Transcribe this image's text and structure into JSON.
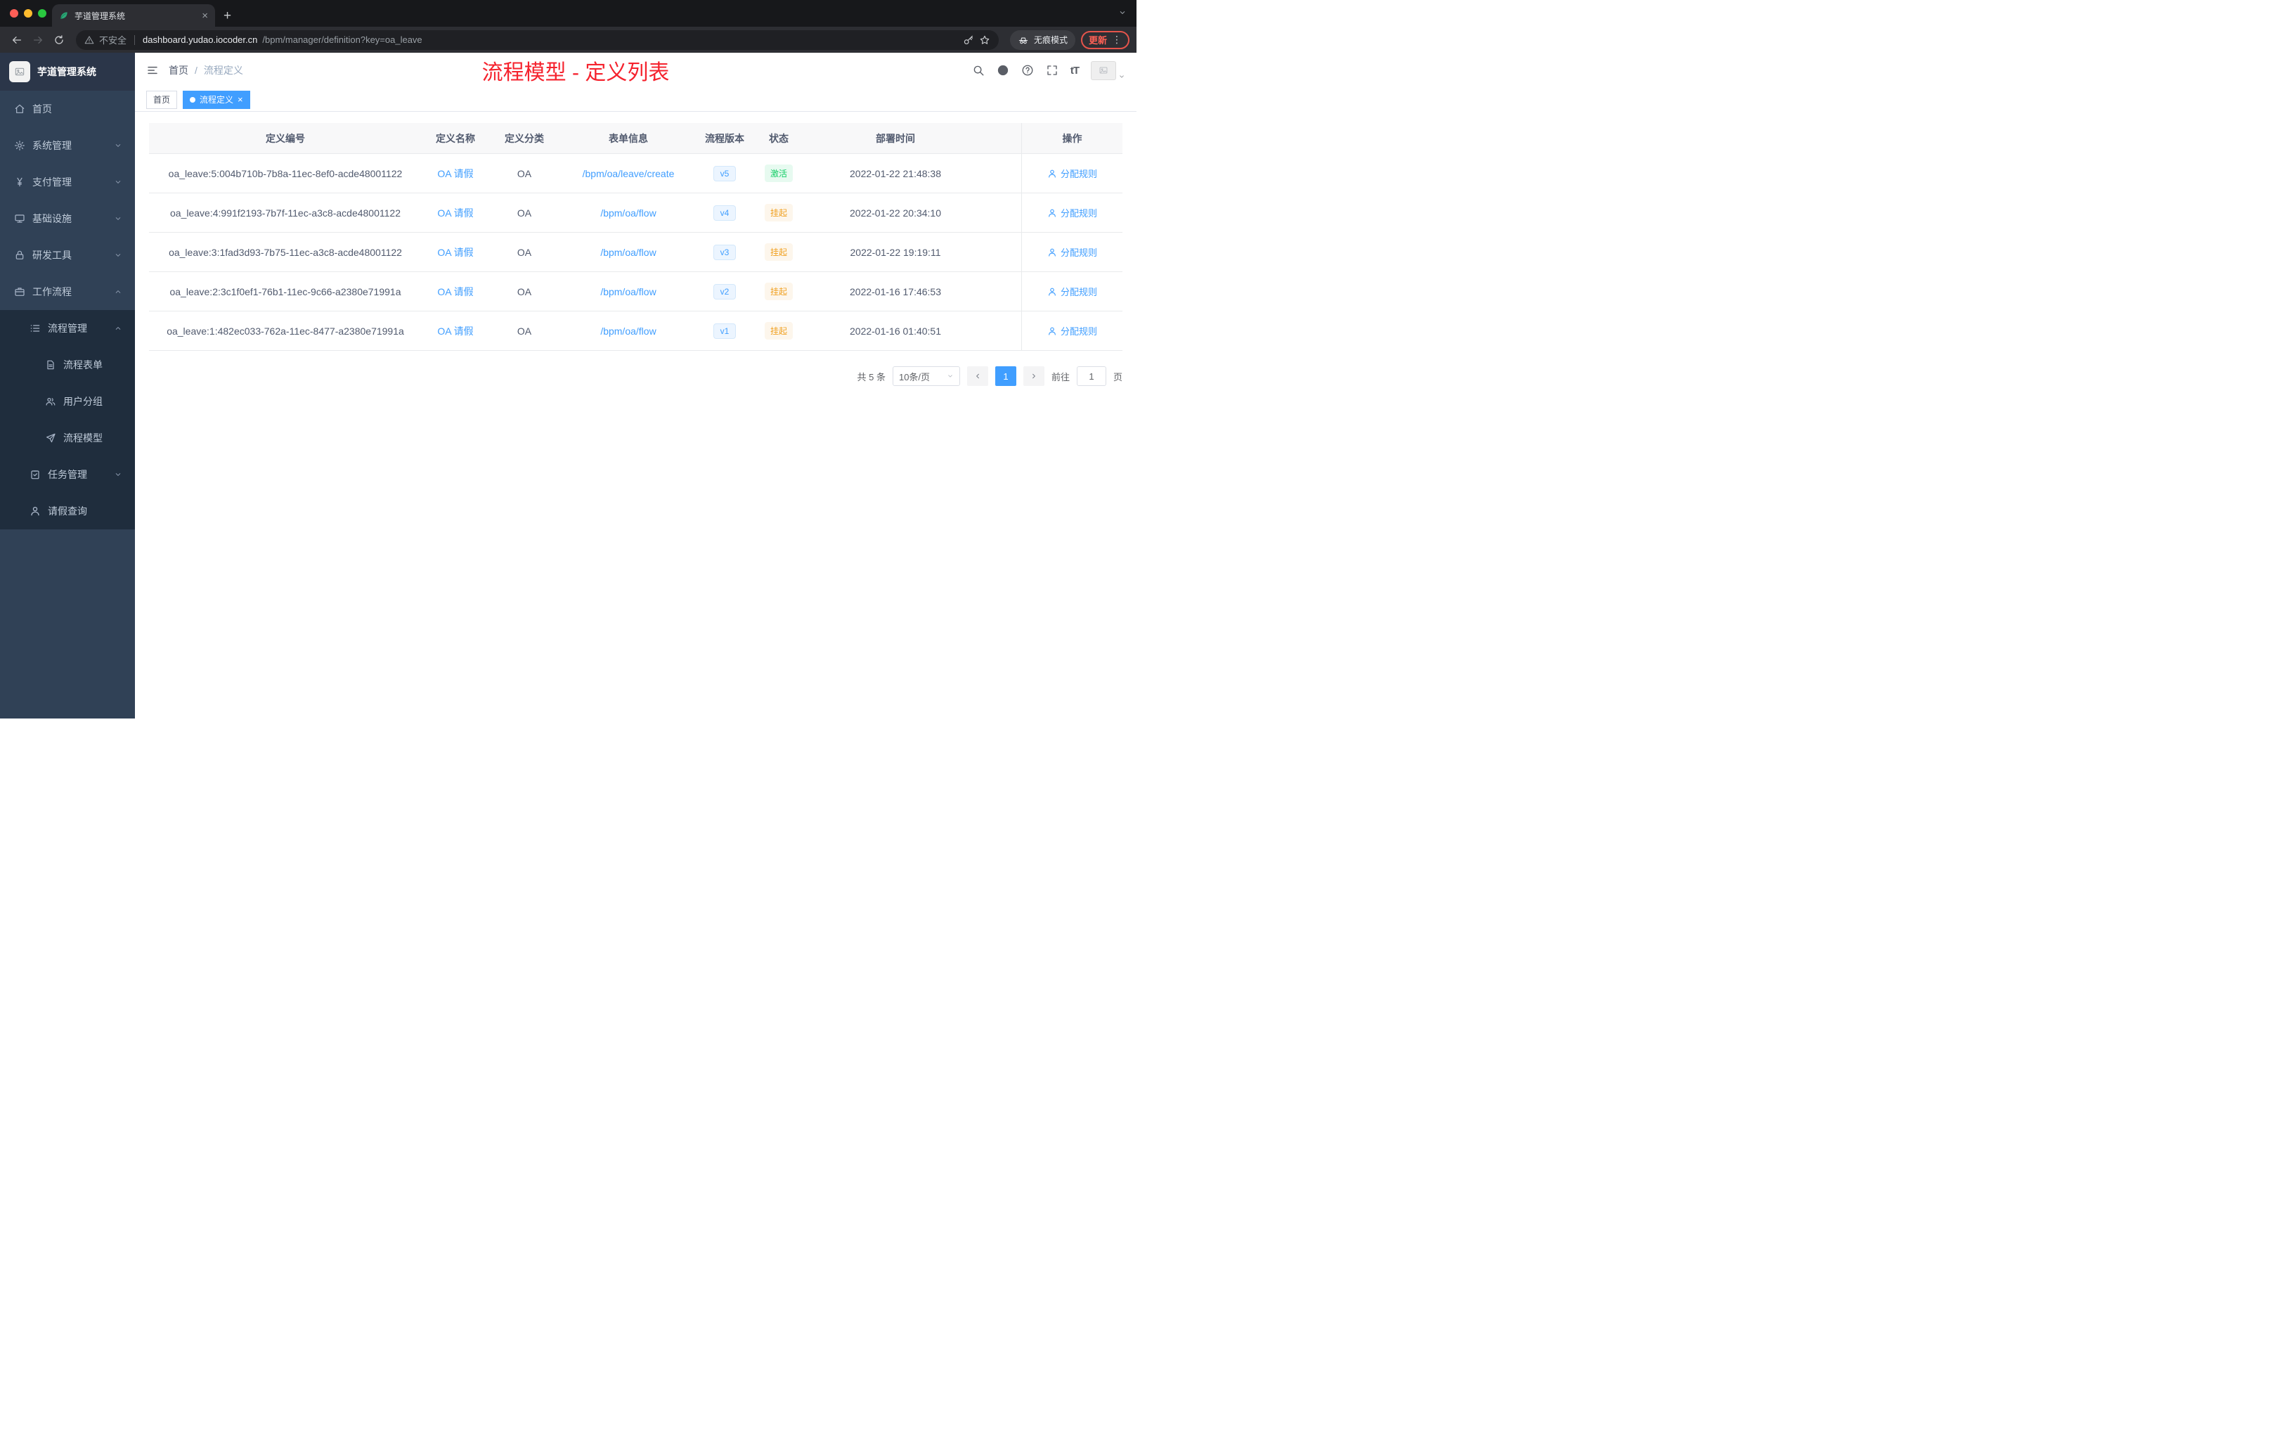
{
  "colors": {
    "accent": "#409eff",
    "annotation_red": "#f5222d",
    "sidebar_bg": "#304156",
    "submenu_bg": "#1f2d3d",
    "success_green": "#13ce66",
    "warning_orange": "#f0a020"
  },
  "browser": {
    "tab_title": "芋道管理系统",
    "security_text": "不安全",
    "domain": "dashboard.yudao.iocoder.cn",
    "path": "/bpm/manager/definition?key=oa_leave",
    "incognito_label": "无痕模式",
    "update_label": "更新"
  },
  "sidebar": {
    "logo_title": "芋道管理系统",
    "items": [
      {
        "key": "home",
        "label": "首页",
        "icon": "home",
        "depth": 0
      },
      {
        "key": "system",
        "label": "系统管理",
        "icon": "gear",
        "depth": 0,
        "chevron": "down"
      },
      {
        "key": "payment",
        "label": "支付管理",
        "icon": "yen",
        "depth": 0,
        "chevron": "down"
      },
      {
        "key": "infra",
        "label": "基础设施",
        "icon": "infra",
        "depth": 0,
        "chevron": "down"
      },
      {
        "key": "devtools",
        "label": "研发工具",
        "icon": "tool",
        "depth": 0,
        "chevron": "down"
      },
      {
        "key": "workflow",
        "label": "工作流程",
        "icon": "case",
        "depth": 0,
        "chevron": "up"
      },
      {
        "key": "process-manage",
        "label": "流程管理",
        "icon": "list",
        "depth": 1,
        "chevron": "up"
      },
      {
        "key": "process-form",
        "label": "流程表单",
        "icon": "doc",
        "depth": 2
      },
      {
        "key": "user-group",
        "label": "用户分组",
        "icon": "users",
        "depth": 2
      },
      {
        "key": "process-model",
        "label": "流程模型",
        "icon": "send",
        "depth": 2
      },
      {
        "key": "task-manage",
        "label": "任务管理",
        "icon": "task",
        "depth": 1,
        "chevron": "down"
      },
      {
        "key": "leave-query",
        "label": "请假查询",
        "icon": "user",
        "depth": 1
      }
    ]
  },
  "header": {
    "breadcrumb_home": "首页",
    "breadcrumb_separator": "/",
    "breadcrumb_current": "流程定义",
    "annotation": "流程模型 - 定义列表",
    "font_size_label": "tT"
  },
  "tags": {
    "items": [
      {
        "label": "首页",
        "active": false
      },
      {
        "label": "流程定义",
        "active": true
      }
    ]
  },
  "table": {
    "columns": [
      "定义编号",
      "定义名称",
      "定义分类",
      "表单信息",
      "流程版本",
      "状态",
      "部署时间",
      "操作"
    ],
    "rows": [
      {
        "id": "oa_leave:5:004b710b-7b8a-11ec-8ef0-acde48001122",
        "name": "OA 请假",
        "category": "OA",
        "form": "/bpm/oa/leave/create",
        "version": "v5",
        "status": "激活",
        "status_type": "success",
        "time": "2022-01-22 21:48:38",
        "action": "分配规则"
      },
      {
        "id": "oa_leave:4:991f2193-7b7f-11ec-a3c8-acde48001122",
        "name": "OA 请假",
        "category": "OA",
        "form": "/bpm/oa/flow",
        "version": "v4",
        "status": "挂起",
        "status_type": "warning",
        "time": "2022-01-22 20:34:10",
        "action": "分配规则"
      },
      {
        "id": "oa_leave:3:1fad3d93-7b75-11ec-a3c8-acde48001122",
        "name": "OA 请假",
        "category": "OA",
        "form": "/bpm/oa/flow",
        "version": "v3",
        "status": "挂起",
        "status_type": "warning",
        "time": "2022-01-22 19:19:11",
        "action": "分配规则"
      },
      {
        "id": "oa_leave:2:3c1f0ef1-76b1-11ec-9c66-a2380e71991a",
        "name": "OA 请假",
        "category": "OA",
        "form": "/bpm/oa/flow",
        "version": "v2",
        "status": "挂起",
        "status_type": "warning",
        "time": "2022-01-16 17:46:53",
        "action": "分配规则"
      },
      {
        "id": "oa_leave:1:482ec033-762a-11ec-8477-a2380e71991a",
        "name": "OA 请假",
        "category": "OA",
        "form": "/bpm/oa/flow",
        "version": "v1",
        "status": "挂起",
        "status_type": "warning",
        "time": "2022-01-16 01:40:51",
        "action": "分配规则"
      }
    ]
  },
  "pagination": {
    "total_text": "共 5 条",
    "page_size": "10条/页",
    "current_page": "1",
    "goto_label": "前往",
    "goto_value": "1",
    "page_unit": "页"
  }
}
